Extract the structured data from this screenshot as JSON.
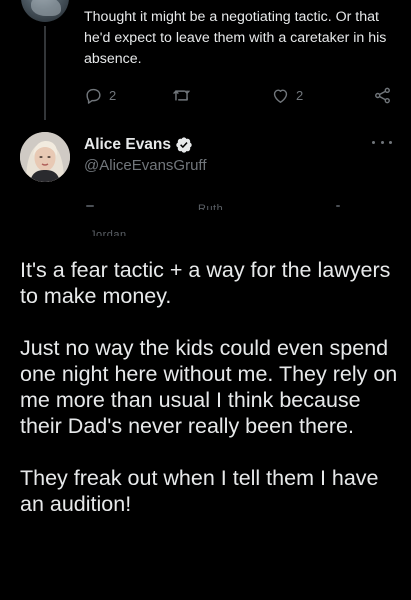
{
  "previous_tweet": {
    "text": "Thought it might be a negotiating tactic.  Or that he'd expect to leave them with a caretaker in his absence.",
    "actions": {
      "reply_count": "2",
      "retweet_count": "",
      "like_count": "2"
    },
    "icons": [
      "reply-icon",
      "retweet-icon",
      "like-icon",
      "share-icon"
    ]
  },
  "tweet": {
    "author": {
      "display_name": "Alice Evans",
      "handle": "@AliceEvansGruff",
      "verified": true
    },
    "cut_fragments": {
      "word_a": "Ruth.",
      "word_b": "Jordan"
    },
    "paragraphs": [
      "It's a fear tactic + a way for the lawyers to make money.",
      "Just no way the kids could even spend one night here without me. They rely on me more than usual I think because their Dad's never really been there.",
      "They freak out when I tell them I have an audition!"
    ]
  },
  "colors": {
    "background": "#000000",
    "text": "#e7e9ea",
    "muted": "#71767b",
    "verified": "#1d9bf0",
    "thread_line": "#333639"
  }
}
